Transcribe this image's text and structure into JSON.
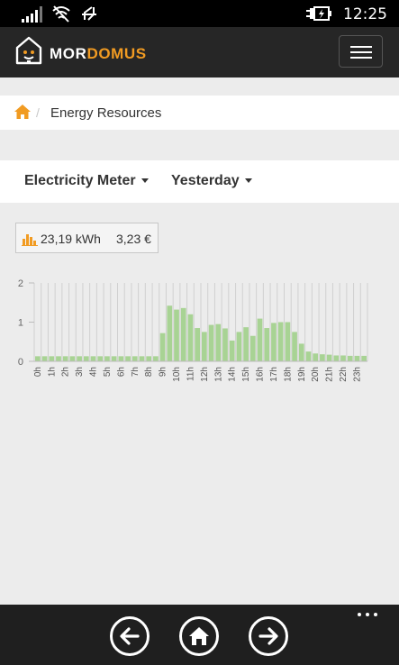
{
  "status_bar": {
    "time": "12:25"
  },
  "app": {
    "brand_part1": "MOR",
    "brand_part2": "DOMUS",
    "brand_color": "#f19b22",
    "menu_icon": "hamburger-icon"
  },
  "breadcrumb": {
    "home_icon": "home-icon",
    "current": "Energy Resources"
  },
  "filters": {
    "meter": "Electricity Meter",
    "period": "Yesterday"
  },
  "summary": {
    "icon": "bar-chart-icon",
    "energy": "23,19 kWh",
    "cost": "3,23 €"
  },
  "chart_data": {
    "type": "bar",
    "categories": [
      "0h",
      "",
      "1h",
      "",
      "2h",
      "",
      "3h",
      "",
      "4h",
      "",
      "5h",
      "",
      "6h",
      "",
      "7h",
      "",
      "8h",
      "",
      "9h",
      "",
      "10h",
      "",
      "11h",
      "",
      "12h",
      "",
      "13h",
      "",
      "14h",
      "",
      "15h",
      "",
      "16h",
      "",
      "17h",
      "",
      "18h",
      "",
      "19h",
      "",
      "20h",
      "",
      "21h",
      "",
      "22h",
      "",
      "23h",
      ""
    ],
    "values": [
      0.13,
      0.13,
      0.13,
      0.13,
      0.13,
      0.13,
      0.13,
      0.13,
      0.13,
      0.13,
      0.13,
      0.13,
      0.13,
      0.13,
      0.13,
      0.13,
      0.13,
      0.13,
      0.72,
      1.42,
      1.32,
      1.36,
      1.2,
      0.85,
      0.75,
      0.93,
      0.95,
      0.84,
      0.53,
      0.75,
      0.87,
      0.65,
      1.09,
      0.85,
      0.98,
      1.0,
      1.0,
      0.75,
      0.45,
      0.25,
      0.2,
      0.18,
      0.17,
      0.15,
      0.15,
      0.14,
      0.14,
      0.14
    ],
    "yticks": [
      0,
      1,
      2
    ],
    "ylim": [
      0,
      2
    ],
    "bar_color": "#a8d394"
  },
  "bottom_nav": {
    "back_icon": "arrow-left-icon",
    "home_icon": "home-icon",
    "forward_icon": "arrow-right-icon",
    "more_icon": "more-dots-icon"
  }
}
